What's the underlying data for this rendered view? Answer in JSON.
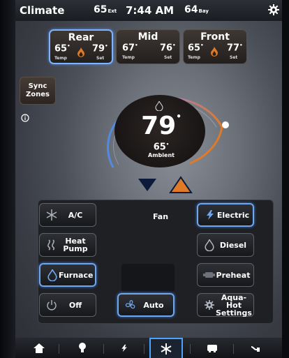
{
  "topbar": {
    "title": "Climate",
    "ext_temp": "65",
    "ext_unit": "Ext",
    "time": "7:44 AM",
    "bay_temp": "64",
    "bay_unit": "Bay"
  },
  "zones": [
    {
      "name": "Rear",
      "temp": "65",
      "temp_label": "Temp",
      "set": "79",
      "set_label": "Set",
      "active": true,
      "heating": true
    },
    {
      "name": "Mid",
      "temp": "67",
      "temp_label": "Temp",
      "set": "76",
      "set_label": "Set",
      "active": false,
      "heating": false
    },
    {
      "name": "Front",
      "temp": "65",
      "temp_label": "Temp",
      "set": "77",
      "set_label": "Set",
      "active": false,
      "heating": true
    }
  ],
  "sync": {
    "label_line1": "Sync",
    "label_line2": "Zones"
  },
  "dial": {
    "setpoint": "79",
    "ambient": "65",
    "ambient_label": "Ambient",
    "setpoint_fraction": 0.75
  },
  "modes": {
    "ac": "A/C",
    "heat_pump_1": "Heat",
    "heat_pump_2": "Pump",
    "furnace": "Furnace",
    "off": "Off",
    "fan_label": "Fan",
    "auto": "Auto",
    "electric": "Electric",
    "diesel": "Diesel",
    "preheat": "Preheat",
    "aquahot_1": "Aqua-Hot",
    "aquahot_2": "Settings"
  },
  "nav": {
    "items": [
      "home-icon",
      "light-bulb-icon",
      "lightning-icon",
      "snowflake-icon",
      "generator-icon",
      "plug-icon"
    ],
    "selected": "snowflake-icon"
  },
  "colors": {
    "accent_blue": "#6fa6ee",
    "heat_orange": "#e07a26",
    "cool_blue": "#4f8be0"
  }
}
